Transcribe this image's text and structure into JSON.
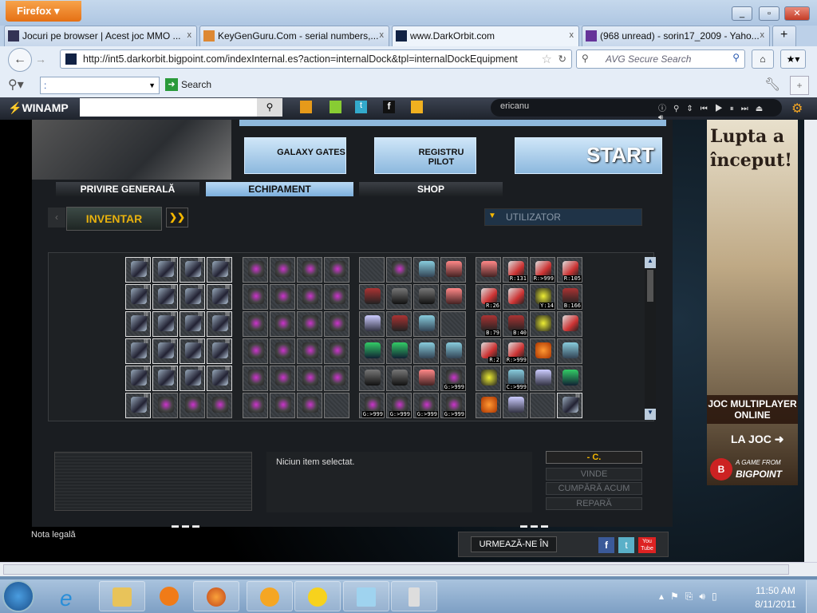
{
  "browser": {
    "menu_label": "Firefox ▾",
    "tabs": [
      {
        "title": "Jocuri pe browser | Acest joc MMO ..."
      },
      {
        "title": "KeyGenGuru.Com - serial numbers,..."
      },
      {
        "title": "www.DarkOrbit.com"
      },
      {
        "title": "(968 unread) - sorin17_2009 - Yaho..."
      }
    ],
    "new_tab": "+",
    "url": "http://int5.darkorbit.bigpoint.com/indexInternal.es?action=internalDock&tpl=internalDockEquipment",
    "search_placeholder": "AVG Secure Search",
    "toolbar_search_value": ":",
    "toolbar_search_label": "Search"
  },
  "winamp": {
    "logo": "WINAMP",
    "track": "ericanu"
  },
  "game": {
    "buttons": {
      "galaxy": "GALAXY GATES",
      "registru": "REGISTRU PILOT",
      "start": "START"
    },
    "tabs": [
      "PRIVIRE GENERALĂ",
      "ECHIPAMENT",
      "SHOP"
    ],
    "inventar": "INVENTAR",
    "dropdown": "UTILIZATOR",
    "detail_text": "Niciun item selectat.",
    "price": "- C.",
    "actions": [
      "VINDE",
      "CUMPĂRĂ ACUM",
      "REPARĂ"
    ],
    "legal": "Nota legală",
    "follow": "URMEAZĂ-NE ÎN",
    "groups": [
      [
        "L",
        "L",
        "L",
        "L",
        "L",
        "L",
        "L",
        "L",
        "L",
        "L",
        "L",
        "L",
        "L",
        "L",
        "L",
        "L",
        "L",
        "L",
        "L",
        "L",
        "L",
        "G",
        "G",
        "G"
      ],
      [
        "G",
        "G",
        "G",
        "G",
        "G",
        "G",
        "G",
        "G",
        "G",
        "G",
        "G",
        "G",
        "G",
        "G",
        "G",
        "G",
        "G",
        "G",
        "G",
        "G",
        "G",
        "G",
        "G",
        ""
      ],
      [
        "",
        "G",
        "C",
        "X",
        "B",
        "D",
        "D",
        "X",
        "P",
        "B",
        "C",
        "",
        "E",
        "E",
        "C",
        "C",
        "D",
        "D",
        "X",
        "G:>999",
        "G:>999",
        "G:>999",
        "G:>999",
        "G:>999"
      ],
      [
        "X",
        "R:131",
        "R:>999",
        "R:105",
        "R:26",
        "R:",
        "Y:14",
        "B:166",
        "B:79",
        "B:40",
        "Y:",
        "R:",
        "R:2",
        "R:>999",
        "O:",
        "C:",
        "Y:",
        "C:>999",
        "P:",
        "E:",
        "O:",
        "P:",
        "",
        "L"
      ]
    ]
  },
  "ad": {
    "headline": "Lupta a început!",
    "line1": "JOC MULTIPLAYER ONLINE",
    "cta": "LA JOC ➜",
    "brand_small": "A GAME FROM",
    "brand": "BIGPOINT"
  },
  "taskbar": {
    "time": "11:50 AM",
    "date": "8/11/2011"
  }
}
